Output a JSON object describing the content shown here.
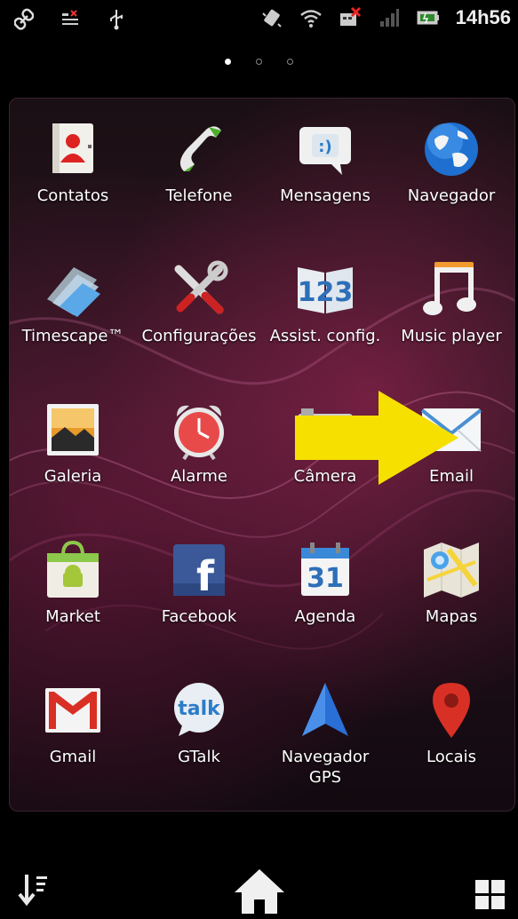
{
  "status_bar": {
    "time": "14h56",
    "icons": [
      "link-icon",
      "notification-list-icon",
      "usb-icon",
      "vibrate-icon",
      "wifi-icon",
      "missed-alert-icon",
      "signal-icon",
      "battery-icon"
    ]
  },
  "pager": {
    "pages": 3,
    "active_page": 1
  },
  "apps": [
    {
      "label": "Contatos",
      "icon": "contacts-icon"
    },
    {
      "label": "Telefone",
      "icon": "phone-icon"
    },
    {
      "label": "Mensagens",
      "icon": "messages-icon"
    },
    {
      "label": "Navegador",
      "icon": "browser-globe-icon"
    },
    {
      "label": "Timescape™",
      "icon": "timescape-icon"
    },
    {
      "label": "Configurações",
      "icon": "settings-tools-icon"
    },
    {
      "label": "Assist. config.",
      "icon": "setup-wizard-icon"
    },
    {
      "label": "Music player",
      "icon": "music-note-icon"
    },
    {
      "label": "Galeria",
      "icon": "gallery-icon"
    },
    {
      "label": "Alarme",
      "icon": "alarm-clock-icon"
    },
    {
      "label": "Câmera",
      "icon": "camera-icon"
    },
    {
      "label": "Email",
      "icon": "email-envelope-icon"
    },
    {
      "label": "Market",
      "icon": "market-bag-icon"
    },
    {
      "label": "Facebook",
      "icon": "facebook-icon"
    },
    {
      "label": "Agenda",
      "icon": "calendar-icon"
    },
    {
      "label": "Mapas",
      "icon": "maps-icon"
    },
    {
      "label": "Gmail",
      "icon": "gmail-icon"
    },
    {
      "label": "GTalk",
      "icon": "gtalk-icon"
    },
    {
      "label": "Navegador\nGPS",
      "icon": "gps-navigation-icon"
    },
    {
      "label": "Locais",
      "icon": "places-pin-icon"
    }
  ],
  "icon_text": {
    "messages": ":)",
    "setup": "123",
    "calendar": "31",
    "facebook": "f",
    "gtalk": "talk"
  },
  "annotation": {
    "type": "arrow",
    "color": "#f5e000",
    "points_to": "Email"
  },
  "dock": {
    "left": "sort-icon",
    "center": "home-icon",
    "right": "grid-view-icon"
  }
}
